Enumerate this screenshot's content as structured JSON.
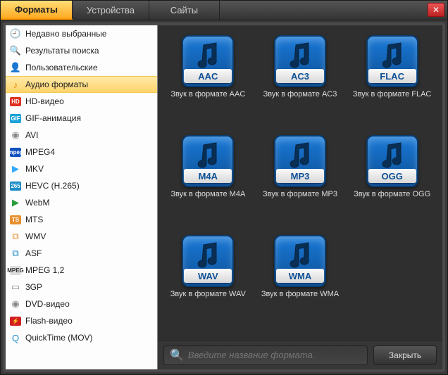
{
  "tabs": [
    {
      "label": "Форматы",
      "active": true
    },
    {
      "label": "Устройства",
      "active": false
    },
    {
      "label": "Сайты",
      "active": false
    }
  ],
  "sidebar": {
    "items": [
      {
        "label": "Недавно выбранные",
        "icon": "recent",
        "selected": false
      },
      {
        "label": "Результаты поиска",
        "icon": "search",
        "selected": false
      },
      {
        "label": "Пользовательские",
        "icon": "user",
        "selected": false
      },
      {
        "label": "Аудио форматы",
        "icon": "audio",
        "selected": true
      },
      {
        "label": "HD-видео",
        "icon": "hd",
        "selected": false
      },
      {
        "label": "GIF-анимация",
        "icon": "gif",
        "selected": false
      },
      {
        "label": "AVI",
        "icon": "avi",
        "selected": false
      },
      {
        "label": "MPEG4",
        "icon": "mpeg4",
        "selected": false
      },
      {
        "label": "MKV",
        "icon": "mkv",
        "selected": false
      },
      {
        "label": "HEVC (H.265)",
        "icon": "hevc",
        "selected": false
      },
      {
        "label": "WebM",
        "icon": "webm",
        "selected": false
      },
      {
        "label": "MTS",
        "icon": "mts",
        "selected": false
      },
      {
        "label": "WMV",
        "icon": "wmv",
        "selected": false
      },
      {
        "label": "ASF",
        "icon": "asf",
        "selected": false
      },
      {
        "label": "MPEG 1,2",
        "icon": "mpeg12",
        "selected": false
      },
      {
        "label": "3GP",
        "icon": "3gp",
        "selected": false
      },
      {
        "label": "DVD-видео",
        "icon": "dvd",
        "selected": false
      },
      {
        "label": "Flash-видео",
        "icon": "flash",
        "selected": false
      },
      {
        "label": "QuickTime (MOV)",
        "icon": "qt",
        "selected": false
      }
    ]
  },
  "formats": [
    {
      "code": "AAC",
      "desc": "Звук в формате AAC"
    },
    {
      "code": "AC3",
      "desc": "Звук в формате AC3"
    },
    {
      "code": "FLAC",
      "desc": "Звук в формате FLAC"
    },
    {
      "code": "M4A",
      "desc": "Звук в формате M4A"
    },
    {
      "code": "MP3",
      "desc": "Звук в формате MP3"
    },
    {
      "code": "OGG",
      "desc": "Звук в формате OGG"
    },
    {
      "code": "WAV",
      "desc": "Звук в формате WAV"
    },
    {
      "code": "WMA",
      "desc": "Звук в формате WMA"
    }
  ],
  "search": {
    "placeholder": "Введите название формата."
  },
  "footer": {
    "close_label": "Закрыть"
  },
  "icons": {
    "recent": {
      "glyph": "🕘",
      "bg": "",
      "fg": "#555"
    },
    "search": {
      "glyph": "🔍",
      "bg": "",
      "fg": "#555"
    },
    "user": {
      "glyph": "👤",
      "bg": "",
      "fg": "#555"
    },
    "audio": {
      "glyph": "♪",
      "bg": "",
      "fg": "#e08000"
    },
    "hd": {
      "glyph": "HD",
      "bg": "#e03020",
      "fg": "#fff"
    },
    "gif": {
      "glyph": "GIF",
      "bg": "#1aa3d8",
      "fg": "#fff"
    },
    "avi": {
      "glyph": "◉",
      "bg": "",
      "fg": "#888"
    },
    "mpeg4": {
      "glyph": "mpeg",
      "bg": "#1050c0",
      "fg": "#fff"
    },
    "mkv": {
      "glyph": "▶",
      "bg": "",
      "fg": "#33aaff"
    },
    "hevc": {
      "glyph": "265",
      "bg": "#1a8cc8",
      "fg": "#fff"
    },
    "webm": {
      "glyph": "▶",
      "bg": "",
      "fg": "#2a9c3a"
    },
    "mts": {
      "glyph": "TS",
      "bg": "#e89030",
      "fg": "#fff"
    },
    "wmv": {
      "glyph": "⧉",
      "bg": "",
      "fg": "#e89030"
    },
    "asf": {
      "glyph": "⧉",
      "bg": "",
      "fg": "#1a8cc8"
    },
    "mpeg12": {
      "glyph": "MPEG",
      "bg": "#ddd",
      "fg": "#333"
    },
    "3gp": {
      "glyph": "▭",
      "bg": "",
      "fg": "#888"
    },
    "dvd": {
      "glyph": "◉",
      "bg": "",
      "fg": "#888"
    },
    "flash": {
      "glyph": "⚡",
      "bg": "#d02020",
      "fg": "#fff"
    },
    "qt": {
      "glyph": "Q",
      "bg": "",
      "fg": "#1a8cc8"
    }
  }
}
